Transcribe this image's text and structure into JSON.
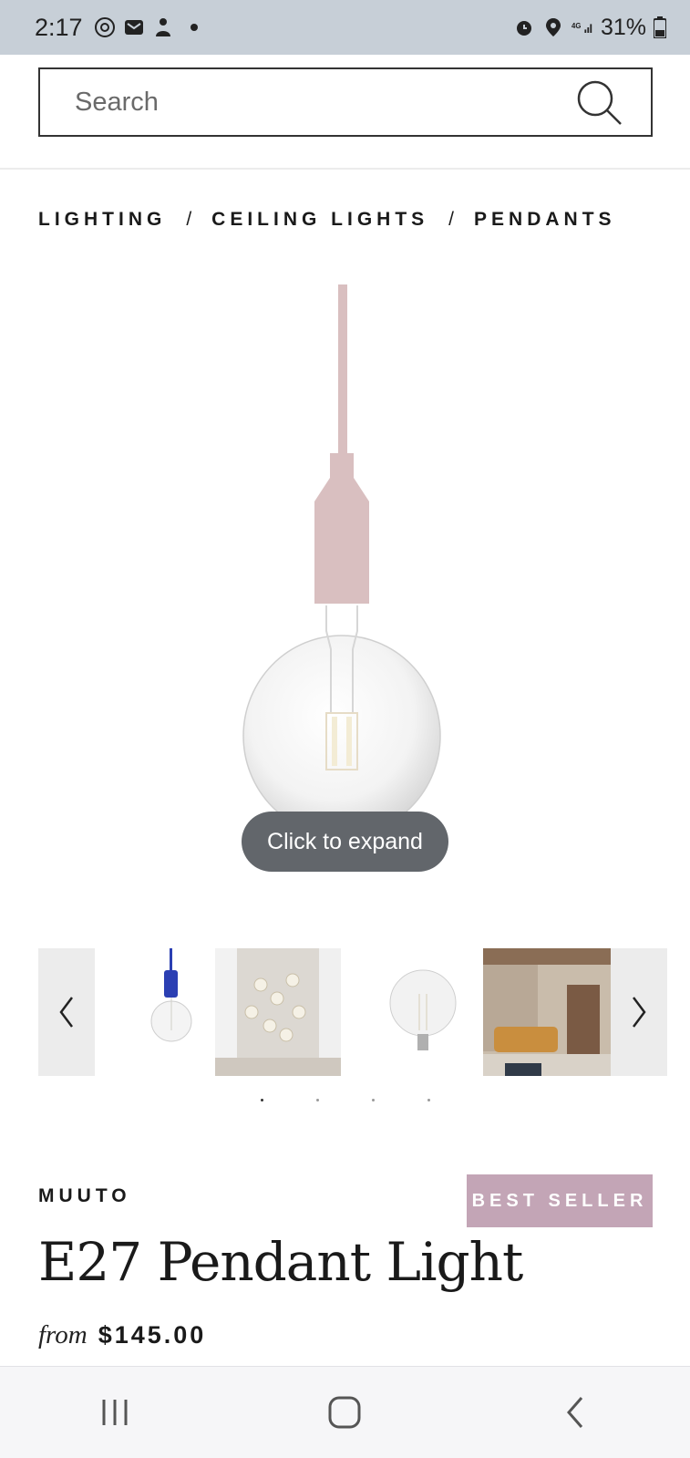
{
  "status_bar": {
    "time": "2:17",
    "battery": "31%"
  },
  "search": {
    "placeholder": "Search"
  },
  "breadcrumb": {
    "items": [
      "LIGHTING",
      "CEILING LIGHTS",
      "PENDANTS"
    ],
    "separator": "/"
  },
  "gallery": {
    "expand_label": "Click to expand",
    "thumbnail_count": 4,
    "active_index": 0
  },
  "product": {
    "brand": "MUUTO",
    "badge": "BEST SELLER",
    "title": "E27 Pendant Light",
    "price_prefix": "from",
    "price": "$145.00"
  },
  "colors": {
    "cord": "#d9bfc0",
    "badge": "#c3a5b6",
    "status_bar": "#c7cfd7",
    "pill": "#62666b"
  },
  "icons": [
    "threads-icon",
    "mail-icon",
    "app-icon",
    "alarm-icon",
    "location-icon",
    "signal-icon",
    "battery-icon",
    "search-icon",
    "chevron-left-icon",
    "chevron-right-icon",
    "recents-icon",
    "home-icon",
    "back-icon"
  ]
}
